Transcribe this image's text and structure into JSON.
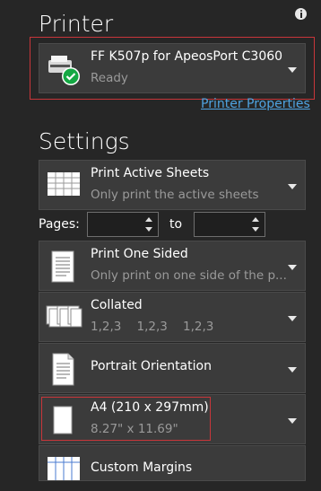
{
  "printer_section": {
    "heading": "Printer",
    "info_icon": "info-icon",
    "selected_printer": {
      "name": "FF K507p for ApeosPort C3060",
      "status": "Ready",
      "icon": "printer-ready-icon"
    },
    "properties_link": "Printer Properties"
  },
  "settings_section": {
    "heading": "Settings",
    "print_what": {
      "title": "Print Active Sheets",
      "subtitle": "Only print the active sheets",
      "icon": "sheets-grid-icon"
    },
    "pages": {
      "label": "Pages:",
      "to_label": "to",
      "from_value": "",
      "to_value": ""
    },
    "sides": {
      "title": "Print One Sided",
      "subtitle": "Only print on one side of the p...",
      "icon": "one-sided-page-icon"
    },
    "collation": {
      "title": "Collated",
      "subtitle": "1,2,3    1,2,3    1,2,3",
      "icon": "collated-stack-icon"
    },
    "orientation": {
      "title": "Portrait Orientation",
      "icon": "portrait-page-icon"
    },
    "paper_size": {
      "title": "A4 (210 x 297mm)",
      "subtitle": "8.27\" x 11.69\"",
      "icon": "paper-size-icon"
    },
    "next_item": {
      "title": "Custom Margins",
      "icon": "margins-grid-icon"
    }
  },
  "colors": {
    "background": "#262626",
    "card": "#3b3b3b",
    "link": "#4fa3e0",
    "highlight_box": "#c8363a",
    "success_green": "#14a843"
  }
}
